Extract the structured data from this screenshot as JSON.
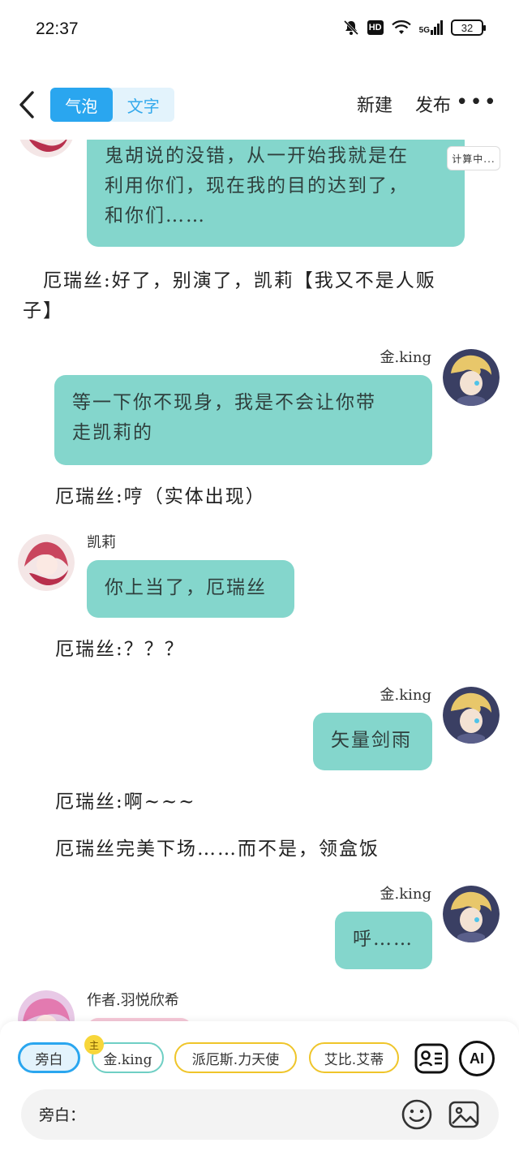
{
  "status_bar": {
    "time": "22:37",
    "hd": "HD",
    "network": "5G",
    "battery": "32"
  },
  "nav": {
    "tabs": [
      {
        "label": "气泡",
        "active": true
      },
      {
        "label": "文字",
        "active": false
      }
    ],
    "new_label": "新建",
    "publish_label": "发布",
    "more_label": "•••"
  },
  "chat": {
    "calc_badge": "计算中...",
    "messages": [
      {
        "id": "m1",
        "type": "bubble",
        "side": "left",
        "text_lines": [
          "鬼胡说的没错，从一开始我就是在",
          "利用你们，现在我的目的达到了，",
          "和你们……"
        ]
      },
      {
        "id": "m2",
        "type": "narration",
        "text_lines": [
          "　厄瑞丝:好了，别演了，凯莉【我又不是人贩",
          "子】"
        ]
      },
      {
        "id": "m3",
        "type": "bubble",
        "side": "right",
        "name": "金.king",
        "text_lines": [
          "等一下你不现身，我是不会让你带",
          "走凯莉的"
        ]
      },
      {
        "id": "m4",
        "type": "narration",
        "text_lines": [
          "厄瑞丝:哼（实体出现）"
        ]
      },
      {
        "id": "m5",
        "type": "bubble",
        "side": "left",
        "name": "凯莉",
        "text_lines": [
          "你上当了，厄瑞丝"
        ]
      },
      {
        "id": "m6",
        "type": "narration",
        "text_lines": [
          "厄瑞丝:？？？"
        ]
      },
      {
        "id": "m7",
        "type": "bubble",
        "side": "right",
        "name": "金.king",
        "text_lines": [
          "矢量剑雨"
        ]
      },
      {
        "id": "m8",
        "type": "narration",
        "text_lines": [
          "厄瑞丝:啊~~~"
        ]
      },
      {
        "id": "m9",
        "type": "narration",
        "text_lines": [
          "厄瑞丝完美下场……而不是，领盒饭"
        ]
      },
      {
        "id": "m10",
        "type": "bubble",
        "side": "right",
        "name": "金.king",
        "text_lines": [
          "呼……"
        ]
      },
      {
        "id": "m11",
        "type": "bubble",
        "side": "left",
        "name": "作者.羽悦欣希",
        "text_lines": [
          ""
        ]
      }
    ]
  },
  "bottom": {
    "roles": [
      {
        "label": "旁白",
        "style": "selected"
      },
      {
        "label": "金.king",
        "style": "teal",
        "badge": "主"
      },
      {
        "label": "派厄斯.力天使",
        "style": "gold"
      },
      {
        "label": "艾比.艾蒂",
        "style": "gold"
      }
    ],
    "card_icon": "contact-card-icon",
    "ai_label": "AI",
    "input_label": "旁白：",
    "input_placeholder": "",
    "emoji_icon": "smiley-icon",
    "image_icon": "image-icon"
  },
  "colors": {
    "bubble": "#84d6cc",
    "accent": "#2aa6ef",
    "gold": "#efc52a"
  }
}
